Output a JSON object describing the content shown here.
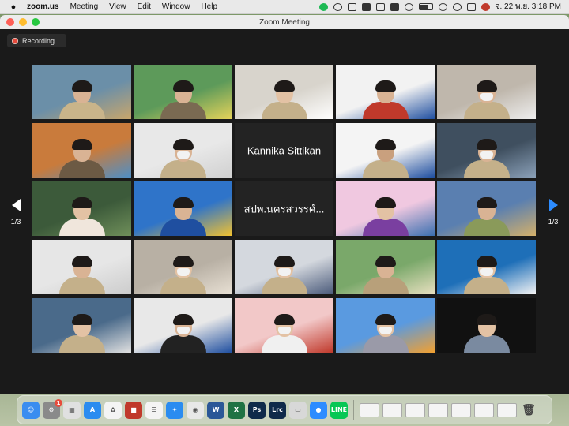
{
  "menubar": {
    "app_name": "zoom.us",
    "menus": [
      "Meeting",
      "View",
      "Edit",
      "Window",
      "Help"
    ],
    "clock": "จ. 22 พ.ย.  3:18 PM"
  },
  "window": {
    "title": "Zoom Meeting",
    "recording_label": "Recording..."
  },
  "pager": {
    "left_label": "1/3",
    "right_label": "1/3"
  },
  "tiles": [
    {
      "kind": "video",
      "bg": "#6b8fa8",
      "accent": "#c9a66b",
      "skin": "#d9b394",
      "shirt": "#c9b48a",
      "mask": false,
      "hair": true
    },
    {
      "kind": "video",
      "bg": "#5d9a5a",
      "accent": "#e6d35a",
      "skin": "#d9b394",
      "shirt": "#7a6a52",
      "mask": false,
      "hair": true
    },
    {
      "kind": "video",
      "bg": "#d8d4cc",
      "accent": "#ffffff",
      "skin": "#e3c2a4",
      "shirt": "#c4b08a",
      "mask": false,
      "hair": true
    },
    {
      "kind": "video",
      "bg": "#f2f2f2",
      "accent": "#1f4fa0",
      "skin": "#d9b394",
      "shirt": "#c0392b",
      "mask": false,
      "hair": true
    },
    {
      "kind": "video",
      "bg": "#bfb7ac",
      "accent": "#eeeeee",
      "skin": "#d9b394",
      "shirt": "#c4b08a",
      "mask": true,
      "hair": true
    },
    {
      "kind": "video",
      "bg": "#c97b3c",
      "accent": "#4f8fc6",
      "skin": "#d9b394",
      "shirt": "#6c5a44",
      "mask": false,
      "hair": true
    },
    {
      "kind": "video",
      "bg": "#e8e8e8",
      "accent": "#d0d0d0",
      "skin": "#d9b394",
      "shirt": "#c4b08a",
      "mask": true,
      "hair": true
    },
    {
      "kind": "name",
      "label": "Kannika Sittikan"
    },
    {
      "kind": "video",
      "bg": "#f4f4f4",
      "accent": "#1f4fa0",
      "skin": "#c9a07e",
      "shirt": "#c4b08a",
      "mask": false,
      "hair": true
    },
    {
      "kind": "video",
      "bg": "#3f4f5f",
      "accent": "#8aa0b8",
      "skin": "#d9b394",
      "shirt": "#c4b08a",
      "mask": true,
      "hair": true
    },
    {
      "kind": "video",
      "bg": "#3c5a3a",
      "accent": "#6f8f5a",
      "skin": "#e3c2a4",
      "shirt": "#f0e6dc",
      "mask": false,
      "hair": true
    },
    {
      "kind": "video",
      "bg": "#2f74c9",
      "accent": "#f2c230",
      "skin": "#d9b394",
      "shirt": "#1f4fa0",
      "mask": false,
      "hair": true
    },
    {
      "kind": "name",
      "label": "สปพ.นครสวรรค์..."
    },
    {
      "kind": "video",
      "bg": "#f0c8e0",
      "accent": "#3a6fb0",
      "skin": "#e3c2a4",
      "shirt": "#7a3fa0",
      "mask": false,
      "hair": true
    },
    {
      "kind": "video",
      "bg": "#5a7fb0",
      "accent": "#d4b06a",
      "skin": "#d9b394",
      "shirt": "#8a9a5a",
      "mask": false,
      "hair": true
    },
    {
      "kind": "video",
      "bg": "#e6e6e6",
      "accent": "#cccccc",
      "skin": "#d9b394",
      "shirt": "#c4b08a",
      "mask": false,
      "hair": true
    },
    {
      "kind": "video",
      "bg": "#b8b0a4",
      "accent": "#e8e0d4",
      "skin": "#e3c2a4",
      "shirt": "#c4b08a",
      "mask": true,
      "hair": true
    },
    {
      "kind": "video",
      "bg": "#d4d8de",
      "accent": "#4a5a7a",
      "skin": "#e3c2a4",
      "shirt": "#c4b08a",
      "mask": true,
      "hair": true
    },
    {
      "kind": "video",
      "bg": "#7aa86a",
      "accent": "#e8e0c0",
      "skin": "#d9b394",
      "shirt": "#b8a07a",
      "mask": false,
      "hair": true
    },
    {
      "kind": "video",
      "bg": "#1e6fb8",
      "accent": "#f4f4f4",
      "skin": "#e3c2a4",
      "shirt": "#c4b08a",
      "mask": true,
      "hair": true
    },
    {
      "kind": "video",
      "bg": "#4a6a8a",
      "accent": "#e0e0e0",
      "skin": "#e3c2a4",
      "shirt": "#c4b08a",
      "mask": false,
      "hair": true
    },
    {
      "kind": "video",
      "bg": "#e8e8e8",
      "accent": "#1f4fa0",
      "skin": "#d9b394",
      "shirt": "#222222",
      "mask": true,
      "hair": true
    },
    {
      "kind": "video",
      "bg": "#f2c8c8",
      "accent": "#c0392b",
      "skin": "#e3c2a4",
      "shirt": "#f0f0f0",
      "mask": true,
      "hair": true
    },
    {
      "kind": "video",
      "bg": "#5a9ae0",
      "accent": "#f2a030",
      "skin": "#e3c2a4",
      "shirt": "#9a9aa8",
      "mask": true,
      "hair": true
    },
    {
      "kind": "video",
      "bg": "#111111",
      "accent": "#111111",
      "skin": "#e3c2a4",
      "shirt": "#7a8aa0",
      "mask": false,
      "hair": true
    }
  ],
  "dock": {
    "apps": [
      {
        "name": "finder",
        "color": "#3a8df0",
        "glyph": "☺"
      },
      {
        "name": "system-preferences",
        "color": "#8a8a8a",
        "glyph": "⚙",
        "badge": "1"
      },
      {
        "name": "launchpad",
        "color": "#e0e0e0",
        "glyph": "▦"
      },
      {
        "name": "app-store",
        "color": "#2a8cf0",
        "glyph": "A"
      },
      {
        "name": "photos",
        "color": "#f4f4f4",
        "glyph": "✿"
      },
      {
        "name": "photo-booth",
        "color": "#c0392b",
        "glyph": "■"
      },
      {
        "name": "reminders",
        "color": "#f4f4f4",
        "glyph": "☰"
      },
      {
        "name": "safari",
        "color": "#2a8cf0",
        "glyph": "✦"
      },
      {
        "name": "chrome",
        "color": "#e8e8e8",
        "glyph": "◉"
      },
      {
        "name": "word",
        "color": "#2b5797",
        "glyph": "W"
      },
      {
        "name": "excel",
        "color": "#1f7244",
        "glyph": "X"
      },
      {
        "name": "photoshop",
        "color": "#0f2a4a",
        "glyph": "Ps"
      },
      {
        "name": "lightroom",
        "color": "#0f2a4a",
        "glyph": "Lrc"
      },
      {
        "name": "preview",
        "color": "#d8d8d8",
        "glyph": "▭"
      },
      {
        "name": "zoom",
        "color": "#2d8cff",
        "glyph": "●"
      },
      {
        "name": "line",
        "color": "#06c755",
        "glyph": "LINE"
      }
    ],
    "docs_count": 7,
    "trash_glyph": "🗑"
  },
  "colors": {
    "zoom_blue": "#2d8cff",
    "recording_red": "#e64a3c",
    "window_bg": "#1a1a1a"
  }
}
